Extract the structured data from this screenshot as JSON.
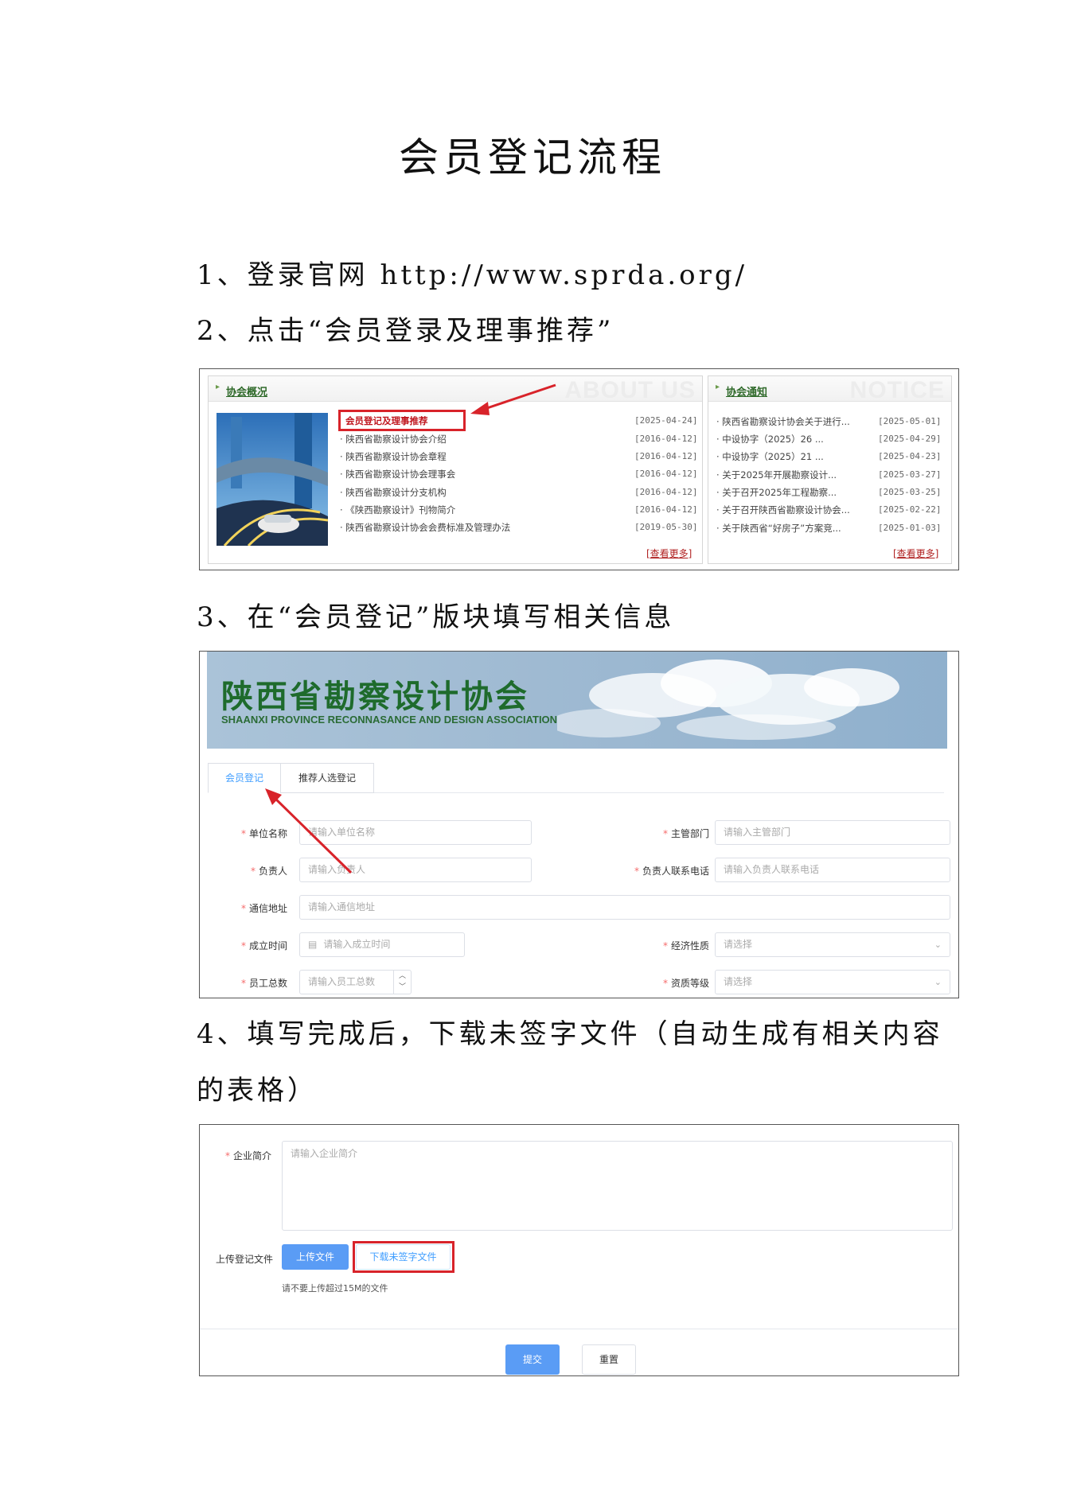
{
  "doc_title": "会员登记流程",
  "steps": {
    "s1": "1、登录官网 http://www.sprda.org/",
    "s2": "2、点击“会员登录及理事推荐”",
    "s3": "3、在“会员登记”版块填写相关信息",
    "s4a": "4、填写完成后，下载未签字文件（自动生成有相关内容",
    "s4b": "的表格）"
  },
  "about_panel": {
    "title": "协会概况",
    "watermark": "ABOUT US",
    "items": [
      {
        "text": "会员登记及理事推荐",
        "date": "[2025-04-24]"
      },
      {
        "text": "· 陕西省勘察设计协会介绍",
        "date": "[2016-04-12]"
      },
      {
        "text": "· 陕西省勘察设计协会章程",
        "date": "[2016-04-12]"
      },
      {
        "text": "· 陕西省勘察设计协会理事会",
        "date": "[2016-04-12]"
      },
      {
        "text": "· 陕西省勘察设计分支机构",
        "date": "[2016-04-12]"
      },
      {
        "text": "· 《陕西勘察设计》刊物简介",
        "date": "[2016-04-12]"
      },
      {
        "text": "· 陕西省勘察设计协会会费标准及管理办法",
        "date": "[2019-05-30]"
      }
    ],
    "more": "[查看更多]"
  },
  "notice_panel": {
    "title": "协会通知",
    "watermark": "NOTICE",
    "items": [
      {
        "text": "· 陕西省勘察设计协会关于进行...",
        "date": "[2025-05-01]"
      },
      {
        "text": "· 中设协字（2025）26 ...",
        "date": "[2025-04-29]"
      },
      {
        "text": "· 中设协字（2025）21 ...",
        "date": "[2025-04-23]"
      },
      {
        "text": "· 关于2025年开展勘察设计...",
        "date": "[2025-03-27]"
      },
      {
        "text": "· 关于召开2025年工程勘察...",
        "date": "[2025-03-25]"
      },
      {
        "text": "· 关于召开陕西省勘察设计协会...",
        "date": "[2025-02-22]"
      },
      {
        "text": "· 关于陕西省“好房子”方案竞...",
        "date": "[2025-01-03]"
      }
    ],
    "more": "[查看更多]"
  },
  "register": {
    "banner_title": "陕西省勘察设计协会",
    "banner_sub": "SHAANXI PROVINCE RECONNASANCE AND DESIGN ASSOCIATION",
    "tabs": [
      "会员登记",
      "推荐人选登记"
    ],
    "fields": {
      "unit_name": {
        "label": "单位名称",
        "placeholder": "请输入单位名称"
      },
      "dept": {
        "label": "主管部门",
        "placeholder": "请输入主管部门"
      },
      "leader": {
        "label": "负责人",
        "placeholder": "请输入负责人"
      },
      "leader_phone": {
        "label": "负责人联系电话",
        "placeholder": "请输入负责人联系电话"
      },
      "address": {
        "label": "通信地址",
        "placeholder": "请输入通信地址"
      },
      "founded": {
        "label": "成立时间",
        "placeholder": "请输入成立时间"
      },
      "economy": {
        "label": "经济性质",
        "placeholder": "请选择"
      },
      "staff": {
        "label": "员工总数",
        "placeholder": "请输入员工总数"
      },
      "grade": {
        "label": "资质等级",
        "placeholder": "请选择"
      }
    },
    "required_mark": "*"
  },
  "upload": {
    "intro_label": "企业简介",
    "intro_placeholder": "请输入企业简介",
    "upload_label": "上传登记文件",
    "upload_btn": "上传文件",
    "download_btn": "下载未签字文件",
    "hint": "请不要上传超过15M的文件",
    "submit": "提交",
    "reset": "重置"
  },
  "colors": {
    "highlight": "#d8232a",
    "primary": "#5a9cf5",
    "link": "#409eff"
  }
}
